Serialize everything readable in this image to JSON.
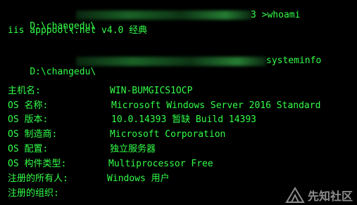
{
  "colors": {
    "background": "#000000",
    "text": "#32ff48"
  },
  "line1": {
    "path": "D:\\changedu\\",
    "tail": "3 >whoami"
  },
  "line2": "iis apppool\\.net v4.0 经典",
  "line3": {
    "path": "D:\\changedu\\",
    "tail": "systeminfo"
  },
  "info": [
    {
      "label": "主机名:",
      "value": "WIN-BUMGICS1OCP"
    },
    {
      "label": "OS 名称:",
      "value": "Microsoft Windows Server 2016 Standard"
    },
    {
      "label": "OS 版本:",
      "value": "10.0.14393 暂缺 Build 14393"
    },
    {
      "label": "OS 制造商:",
      "value": "Microsoft Corporation"
    },
    {
      "label": "OS 配置:",
      "value": "独立服务器"
    },
    {
      "label": "OS 构件类型:",
      "value": "Multiprocessor Free"
    },
    {
      "label": "注册的所有人:",
      "value": "Windows 用户"
    },
    {
      "label": "注册的组织:",
      "value": ""
    }
  ],
  "watermark": {
    "text": "先知社区",
    "icon": "xianzhi-logo-icon"
  }
}
